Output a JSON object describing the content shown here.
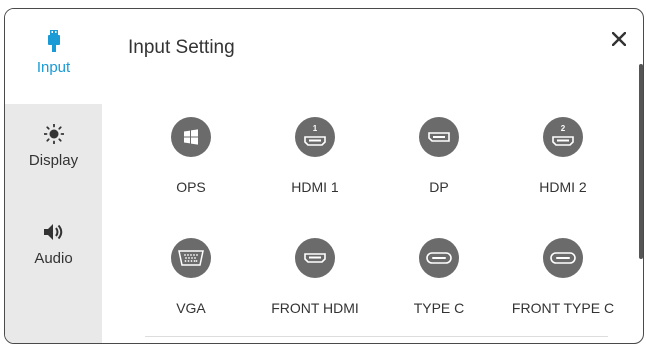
{
  "dialog": {
    "title": "Input Setting",
    "close_icon": "close-icon"
  },
  "sidebar": {
    "items": [
      {
        "label": "Input",
        "icon": "input-plug-icon",
        "active": true
      },
      {
        "label": "Display",
        "icon": "brightness-icon",
        "active": false
      },
      {
        "label": "Audio",
        "icon": "speaker-icon",
        "active": false
      }
    ]
  },
  "sources": [
    {
      "label": "OPS",
      "icon": "windows-icon"
    },
    {
      "label": "HDMI 1",
      "icon": "hdmi-icon",
      "badge": "1"
    },
    {
      "label": "DP",
      "icon": "displayport-icon"
    },
    {
      "label": "HDMI 2",
      "icon": "hdmi-icon",
      "badge": "2"
    },
    {
      "label": "VGA",
      "icon": "vga-icon"
    },
    {
      "label": "FRONT HDMI",
      "icon": "hdmi-icon"
    },
    {
      "label": "TYPE C",
      "icon": "usb-c-icon"
    },
    {
      "label": "FRONT TYPE C",
      "icon": "usb-c-icon"
    }
  ],
  "colors": {
    "accent": "#1a9bd6",
    "icon_circle": "#6b6b6b",
    "sidebar_bg": "#e9e9e9"
  }
}
